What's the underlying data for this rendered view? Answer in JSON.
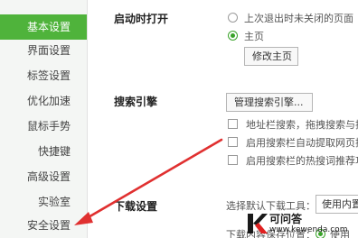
{
  "sidebar": {
    "items": [
      {
        "label": "基本设置",
        "active": true
      },
      {
        "label": "界面设置"
      },
      {
        "label": "标签设置"
      },
      {
        "label": "优化加速"
      },
      {
        "label": "鼠标手势"
      },
      {
        "label": "快捷键"
      },
      {
        "label": "高级设置"
      },
      {
        "label": "实验室"
      },
      {
        "label": "安全设置"
      }
    ]
  },
  "startup": {
    "label": "启动时打开",
    "option_last_session": "上次退出时未关闭的页面",
    "option_homepage": "主页",
    "selected": "主页",
    "edit_homepage_button": "修改主页"
  },
  "search": {
    "label": "搜索引擎",
    "manage_button": "管理搜索引擎...",
    "checkbox_addressbar": "地址栏搜索，拖拽搜索与搜",
    "checkbox_auto_extract": "启用搜索栏自动提取网页搜",
    "checkbox_hot_words": "启用搜索栏的热搜词推荐功"
  },
  "download": {
    "label": "下载设置",
    "tool_label": "选择默认下载工具：",
    "tool_select_value": "使用内置",
    "save_location_label": "下载内容保存位置：",
    "save_option": "使用"
  },
  "watermark": {
    "title": "可问答",
    "url": "www.kewenda.com",
    "colors": {
      "k_dark": "#1a1a1a",
      "k_accent": "#e02020"
    }
  },
  "colors": {
    "accent_green": "#4fb33b",
    "arrow_red": "#e03030"
  }
}
